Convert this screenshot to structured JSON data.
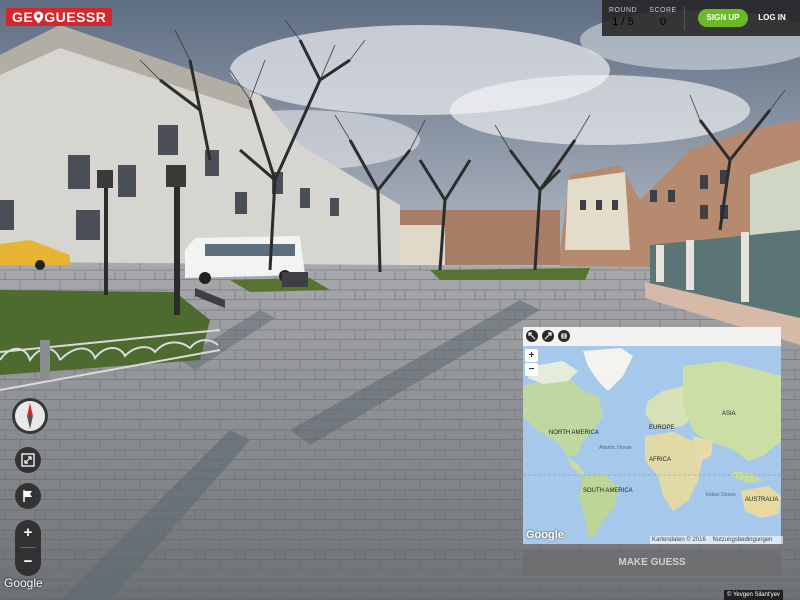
{
  "app": {
    "logo_text_before": "GE",
    "logo_text_after": "GUESSR",
    "brand_color": "#d5262e"
  },
  "game": {
    "round_label": "ROUND",
    "round_value": "1 / 5",
    "score_label": "SCORE",
    "score_value": "0"
  },
  "auth": {
    "signup_label": "SIGN UP",
    "login_label": "LOG IN",
    "signup_color": "#6cb928"
  },
  "controls": {
    "compass_icon": "compass-icon",
    "fullscreen_icon": "fullscreen-icon",
    "flag_icon": "flag-icon",
    "zoom_in_label": "+",
    "zoom_out_label": "−"
  },
  "panorama": {
    "provider_label": "Google",
    "photo_credit": "© Yevgen Silant'yev"
  },
  "map": {
    "tool_icons": [
      "shrink-diagonal-icon",
      "expand-diagonal-icon",
      "pin-toggle-icon"
    ],
    "zoom_in_label": "+",
    "zoom_out_label": "−",
    "labels": {
      "north_america": "NORTH AMERICA",
      "south_america": "SOUTH AMERICA",
      "europe": "EUROPE",
      "africa": "AFRICA",
      "asia": "ASIA",
      "australia": "AUSTRALIA",
      "atlantic_ocean": "Atlantic Ocean",
      "indian_ocean": "Indian Ocean"
    },
    "provider_label": "Google",
    "attribution": "Kartendaten © 2016",
    "terms_label": "Nutzungsbedingungen"
  },
  "actions": {
    "make_guess_label": "MAKE GUESS"
  }
}
